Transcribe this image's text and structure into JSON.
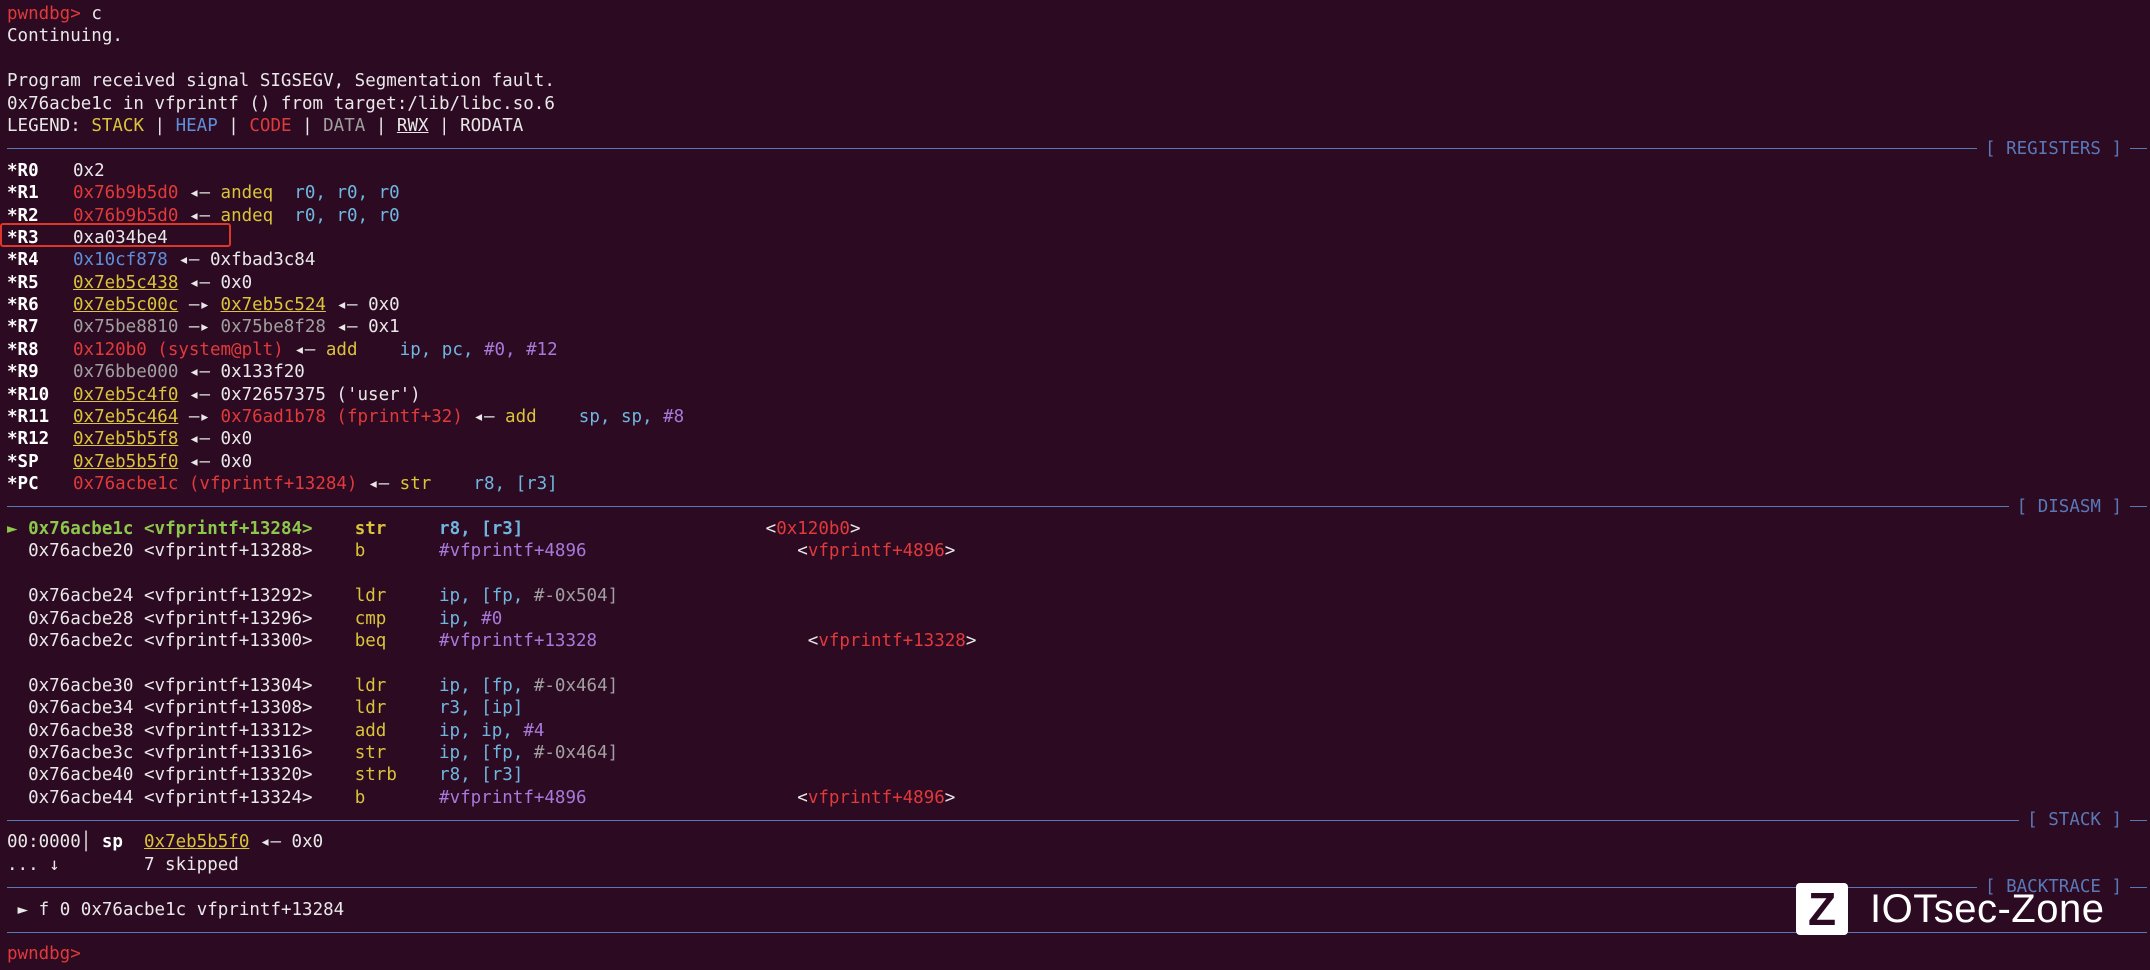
{
  "prompt": "pwndbg>",
  "command": "c",
  "continuing": "Continuing.",
  "signal_msg": "Program received signal SIGSEGV, Segmentation fault.",
  "location_msg": "0x76acbe1c in vfprintf () from target:/lib/libc.so.6",
  "legend": {
    "label": "LEGEND:",
    "stack": "STACK",
    "heap": "HEAP",
    "code": "CODE",
    "data": "DATA",
    "rwx": "RWX",
    "rodata": "RODATA"
  },
  "sections": {
    "registers": "[ REGISTERS ]",
    "disasm": "[ DISASM ]",
    "stack": "[ STACK ]",
    "backtrace": "[ BACKTRACE ]"
  },
  "registers": {
    "r0": {
      "name": "*R0",
      "value": "0x2"
    },
    "r1": {
      "name": "*R1",
      "value": "0x76b9b5d0",
      "arrow": "◂—",
      "mnem": "andeq",
      "ops": "r0, r0, r0"
    },
    "r2": {
      "name": "*R2",
      "value": "0x76b9b5d0",
      "arrow": "◂—",
      "mnem": "andeq",
      "ops": "r0, r0, r0"
    },
    "r3": {
      "name": "*R3",
      "value": "0xa034be4"
    },
    "r4": {
      "name": "*R4",
      "value": "0x10cf878",
      "arrow": "◂—",
      "target": "0xfbad3c84"
    },
    "r5": {
      "name": "*R5",
      "value": "0x7eb5c438",
      "arrow": "◂—",
      "target": "0x0"
    },
    "r6": {
      "name": "*R6",
      "value": "0x7eb5c00c",
      "arrow1": "—▸",
      "mid": "0x7eb5c524",
      "arrow2": "◂—",
      "target": "0x0"
    },
    "r7": {
      "name": "*R7",
      "value": "0x75be8810",
      "arrow1": "—▸",
      "mid": "0x75be8f28",
      "arrow2": "◂—",
      "target": "0x1"
    },
    "r8": {
      "name": "*R8",
      "value": "0x120b0 (system@plt)",
      "arrow": "◂—",
      "mnem": "add",
      "op1": "ip, pc,",
      "op2": "#0, #12"
    },
    "r9": {
      "name": "*R9",
      "value": "0x76bbe000",
      "arrow": "◂—",
      "target": "0x133f20"
    },
    "r10": {
      "name": "*R10",
      "value": "0x7eb5c4f0",
      "arrow": "◂—",
      "target": "0x72657375 ('user')"
    },
    "r11": {
      "name": "*R11",
      "value": "0x7eb5c464",
      "arrow1": "—▸",
      "mid": "0x76ad1b78 (fprintf+32)",
      "arrow2": "◂—",
      "mnem": "add",
      "op1": "sp, sp,",
      "op2": "#8"
    },
    "r12": {
      "name": "*R12",
      "value": "0x7eb5b5f8",
      "arrow": "◂—",
      "target": "0x0"
    },
    "sp": {
      "name": "*SP",
      "value": "0x7eb5b5f0",
      "arrow": "◂—",
      "target": "0x0"
    },
    "pc": {
      "name": "*PC",
      "value": "0x76acbe1c (vfprintf+13284)",
      "arrow": "◂—",
      "mnem": "str",
      "ops": "r8, [r3]"
    }
  },
  "disasm": {
    "current_marker": "►",
    "l0": {
      "addr": "0x76acbe1c",
      "sym": "<vfprintf+13284>",
      "mnem": "str",
      "ops": "r8, [r3]",
      "note_open": "<",
      "note": "0x120b0",
      "note_close": ">"
    },
    "l1": {
      "addr": "0x76acbe20",
      "sym": "<vfprintf+13288>",
      "mnem": "b",
      "ops": "#vfprintf+4896",
      "note_open": "<",
      "note": "vfprintf+4896",
      "note_close": ">"
    },
    "l2": {
      "addr": "0x76acbe24",
      "sym": "<vfprintf+13292>",
      "mnem": "ldr",
      "ops": "ip, [fp,",
      "imm": "#-0x504]"
    },
    "l3": {
      "addr": "0x76acbe28",
      "sym": "<vfprintf+13296>",
      "mnem": "cmp",
      "ops": "ip,",
      "imm": "#0"
    },
    "l4": {
      "addr": "0x76acbe2c",
      "sym": "<vfprintf+13300>",
      "mnem": "beq",
      "ops": "#vfprintf+13328",
      "note_open": "<",
      "note": "vfprintf+13328",
      "note_close": ">"
    },
    "l5": {
      "addr": "0x76acbe30",
      "sym": "<vfprintf+13304>",
      "mnem": "ldr",
      "ops": "ip, [fp,",
      "imm": "#-0x464]"
    },
    "l6": {
      "addr": "0x76acbe34",
      "sym": "<vfprintf+13308>",
      "mnem": "ldr",
      "ops": "r3, [ip]"
    },
    "l7": {
      "addr": "0x76acbe38",
      "sym": "<vfprintf+13312>",
      "mnem": "add",
      "ops": "ip, ip,",
      "imm": "#4"
    },
    "l8": {
      "addr": "0x76acbe3c",
      "sym": "<vfprintf+13316>",
      "mnem": "str",
      "ops": "ip, [fp,",
      "imm": "#-0x464]"
    },
    "l9": {
      "addr": "0x76acbe40",
      "sym": "<vfprintf+13320>",
      "mnem": "strb",
      "ops": "r8, [r3]"
    },
    "l10": {
      "addr": "0x76acbe44",
      "sym": "<vfprintf+13324>",
      "mnem": "b",
      "ops": "#vfprintf+4896",
      "note_open": "<",
      "note": "vfprintf+4896",
      "note_close": ">"
    }
  },
  "stack": {
    "offset": "00:0000│",
    "reg": "sp",
    "addr": "0x7eb5b5f0",
    "arrow": "◂—",
    "value": "0x0",
    "skip_dots": "... ↓",
    "skip_text": "7 skipped"
  },
  "backtrace": {
    "marker": "►",
    "frame": "f 0",
    "addr": "0x76acbe1c",
    "func": "vfprintf+13284"
  },
  "watermark": {
    "logo": "Z",
    "brand": "IOTsec-Zone"
  },
  "colors": {
    "background": "#2c0a22",
    "stack": "#d9c43a",
    "heap": "#5f8fd9",
    "code": "#e03a3a",
    "data": "#a0a0a0",
    "highlight_box": "#e0352b"
  }
}
